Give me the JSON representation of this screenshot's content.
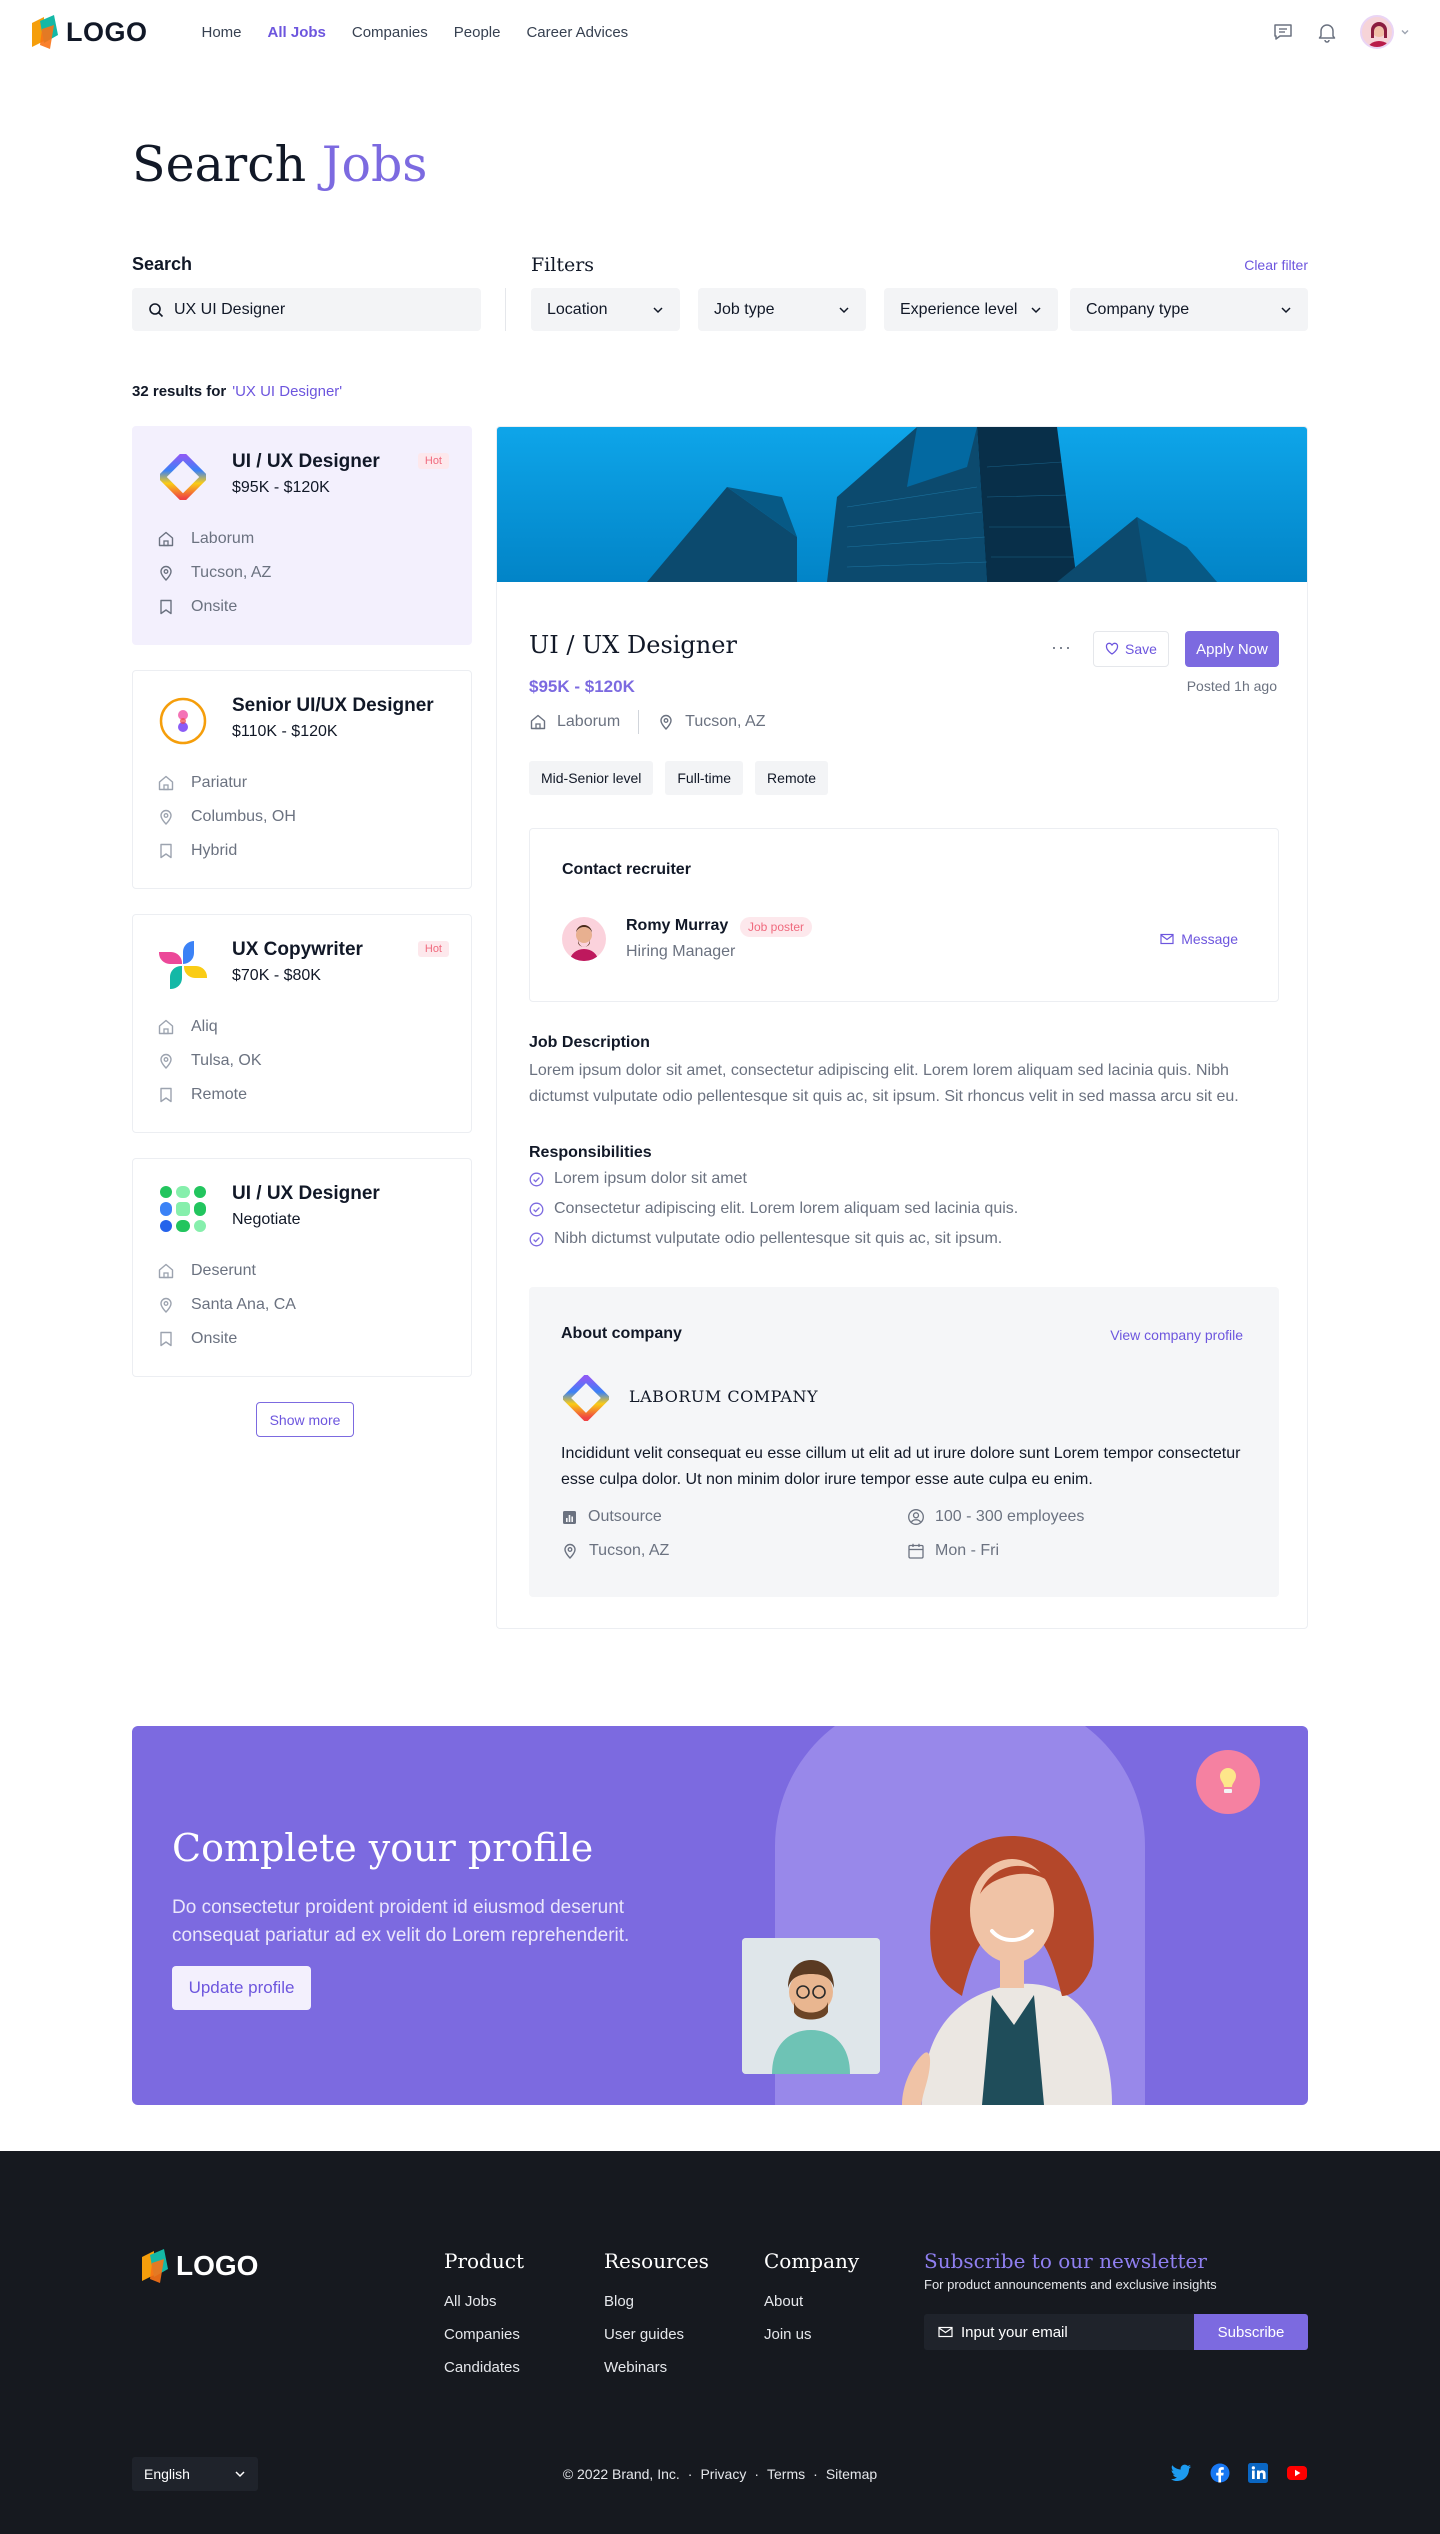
{
  "nav": {
    "logo": "LOGO",
    "links": [
      "Home",
      "All Jobs",
      "Companies",
      "People",
      "Career Advices"
    ],
    "active": "All Jobs"
  },
  "page": {
    "title_main": "Search",
    "title_accent": "Jobs",
    "search_label": "Search",
    "search_value": "UX UI Designer",
    "filters_label": "Filters",
    "clear_filter": "Clear filter",
    "filters": [
      "Location",
      "Job type",
      "Experience level",
      "Company type"
    ],
    "results_count": "32 results for",
    "results_query": "'UX UI Designer'"
  },
  "jobs": [
    {
      "title": "UI / UX Designer",
      "salary": "$95K - $120K",
      "hot": "Hot",
      "company": "Laborum",
      "location": "Tucson, AZ",
      "type": "Onsite"
    },
    {
      "title": "Senior UI/UX Designer",
      "salary": "$110K - $120K",
      "hot": "",
      "company": "Pariatur",
      "location": "Columbus, OH",
      "type": "Hybrid"
    },
    {
      "title": "UX Copywriter",
      "salary": "$70K - $80K",
      "hot": "Hot",
      "company": "Aliq",
      "location": "Tulsa, OK",
      "type": "Remote"
    },
    {
      "title": "UI / UX Designer",
      "salary": "Negotiate",
      "hot": "",
      "company": "Deserunt",
      "location": "Santa Ana, CA",
      "type": "Onsite"
    }
  ],
  "show_more": "Show more",
  "detail": {
    "title": "UI / UX Designer",
    "more": "···",
    "save": "Save",
    "apply": "Apply Now",
    "salary": "$95K - $120K",
    "posted": "Posted 1h ago",
    "company": "Laborum",
    "location": "Tucson, AZ",
    "tags": [
      "Mid-Senior level",
      "Full-time",
      "Remote"
    ],
    "recruiter": {
      "heading": "Contact recruiter",
      "name": "Romy Murray",
      "badge": "Job poster",
      "role": "Hiring Manager",
      "message": "Message"
    },
    "description_heading": "Job Description",
    "description": "Lorem ipsum dolor sit amet, consectetur adipiscing elit. Lorem lorem aliquam sed lacinia quis. Nibh dictumst vulputate odio pellentesque sit quis ac, sit ipsum. Sit rhoncus velit in sed massa arcu sit eu.",
    "responsibilities_heading": "Responsibilities",
    "responsibilities": [
      "Lorem ipsum dolor sit amet",
      "Consectetur adipiscing elit. Lorem lorem aliquam sed lacinia quis.",
      "Nibh dictumst vulputate odio pellentesque sit quis ac, sit ipsum."
    ],
    "about": {
      "heading": "About company",
      "link": "View company profile",
      "name": "LABORUM COMPANY",
      "text": "Incididunt velit consequat eu esse cillum ut elit ad ut irure dolore sunt Lorem tempor consectetur esse culpa dolor. Ut non minim dolor irure tempor esse aute culpa eu enim.",
      "industry": "Outsource",
      "employees": "100 - 300 employees",
      "location": "Tucson, AZ",
      "hours": "Mon - Fri"
    }
  },
  "banner": {
    "title": "Complete your profile",
    "text": "Do consectetur proident proident id eiusmod deserunt consequat pariatur ad ex velit do Lorem reprehenderit.",
    "button": "Update profile"
  },
  "footer": {
    "logo": "LOGO",
    "product": {
      "heading": "Product",
      "links": [
        "All Jobs",
        "Companies",
        "Candidates"
      ]
    },
    "resources": {
      "heading": "Resources",
      "links": [
        "Blog",
        "User guides",
        "Webinars"
      ]
    },
    "company": {
      "heading": "Company",
      "links": [
        "About",
        "Join us"
      ]
    },
    "newsletter_heading": "Subscribe to our newsletter",
    "newsletter_sub": "For product announcements and exclusive insights",
    "email_placeholder": "Input your email",
    "subscribe": "Subscribe",
    "language": "English",
    "copyright": "© 2022 Brand, Inc.",
    "legal": [
      "Privacy",
      "Terms",
      "Sitemap"
    ],
    "socials": [
      "twitter-icon",
      "facebook-icon",
      "linkedin-icon",
      "youtube-icon"
    ]
  },
  "colors": {
    "accent": "#7c6ae0",
    "hot": "#f06a7e",
    "footer_bg": "#16191f"
  }
}
